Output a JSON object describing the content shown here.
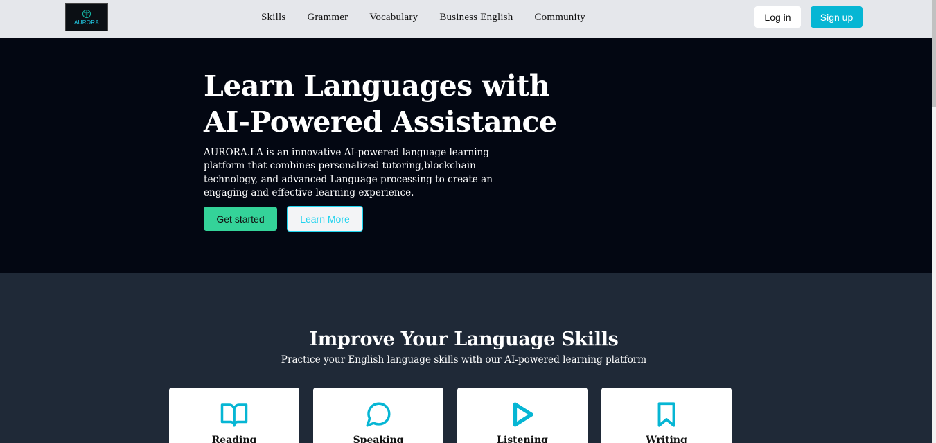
{
  "brand": {
    "logo_text": "AURORA"
  },
  "nav": {
    "links": [
      "Skills",
      "Grammer",
      "Vocabulary",
      "Business English",
      "Community"
    ],
    "login_label": "Log in",
    "signup_label": "Sign up"
  },
  "hero": {
    "title_line1": "Learn Languages with",
    "title_line2": "AI-Powered Assistance",
    "description": "AURORA.LA is an innovative AI-powered language learning platform that combines personalized tutoring,blockchain technology, and advanced Language processing to create an engaging and effective learning experience.",
    "get_started_label": "Get started",
    "learn_more_label": "Learn More"
  },
  "skills": {
    "title": "Improve Your Language Skills",
    "subtitle": "Practice your English language skills with our AI-powered learning platform",
    "cards": [
      {
        "label": "Reading",
        "icon": "book-open-icon"
      },
      {
        "label": "Speaking",
        "icon": "chat-bubble-icon"
      },
      {
        "label": "Listening",
        "icon": "play-icon"
      },
      {
        "label": "Writing",
        "icon": "bookmark-icon"
      }
    ]
  },
  "colors": {
    "accent": "#06b6d4",
    "green": "#34d399",
    "hero_bg": "#030712",
    "section_bg": "#1f2937",
    "nav_bg": "#e5e7eb"
  }
}
